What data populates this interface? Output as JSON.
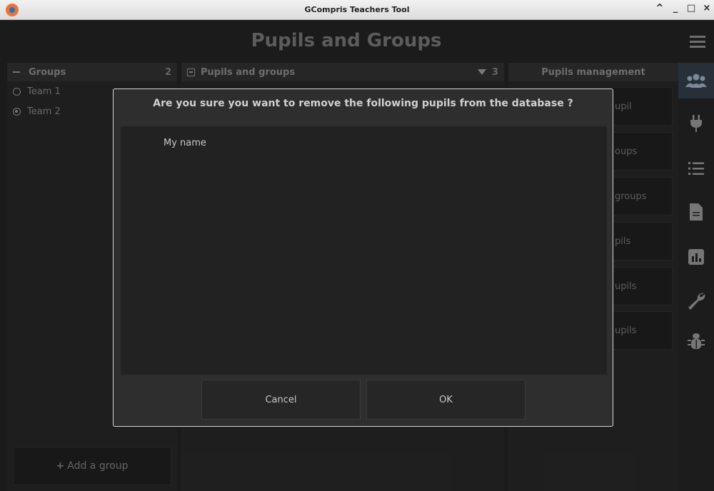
{
  "window": {
    "title": "GCompris Teachers Tool",
    "controls": {
      "collapse": "^",
      "minimize": "_",
      "maximize": "□",
      "close": "×"
    }
  },
  "header": {
    "title": "Pupils and Groups"
  },
  "groups_panel": {
    "heading": "Groups",
    "count": "2",
    "items": [
      {
        "label": "Team 1",
        "selected": false
      },
      {
        "label": "Team 2",
        "selected": true
      }
    ],
    "add_button": {
      "plus": "+",
      "label": "Add a group"
    }
  },
  "pupils_panel": {
    "heading": "Pupils and groups",
    "count": "3"
  },
  "management_panel": {
    "heading": "Pupils management",
    "buttons_visible_text": [
      "upil",
      "oups",
      "groups",
      "pils",
      "upils",
      "upils"
    ]
  },
  "sidebar": {
    "icons": [
      "users-icon",
      "plug-icon",
      "list-icon",
      "document-icon",
      "chart-icon",
      "wrench-icon",
      "bug-icon"
    ],
    "active": "users-icon"
  },
  "dialog": {
    "question": "Are you sure you want to remove the following pupils from the database ?",
    "pupils": [
      "My name"
    ],
    "cancel_label": "Cancel",
    "ok_label": "OK"
  },
  "colors": {
    "background": "#2a2a2a",
    "panel_header": "#3b3b3b",
    "active_sidebar": "#3d4a56",
    "dialog_border": "#d8d8d8"
  }
}
